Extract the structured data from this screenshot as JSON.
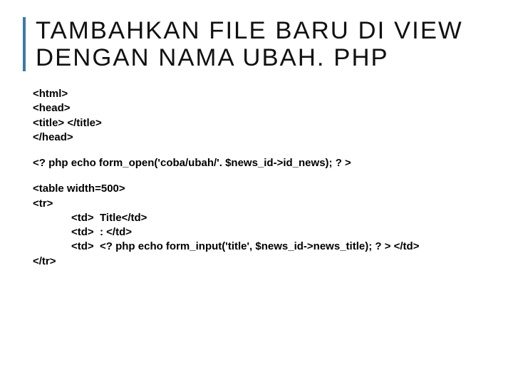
{
  "title": "TAMBAHKAN FILE BARU DI VIEW DENGAN NAMA UBAH. PHP",
  "block1": {
    "l1": "<html>",
    "l2": "<head>",
    "l3": "<title> </title>",
    "l4": "</head>"
  },
  "block2": {
    "l1": "<? php echo form_open('coba/ubah/'. $news_id->id_news); ? >"
  },
  "block3": {
    "l1": "<table width=500>",
    "l2": "<tr>",
    "l3": "<td>  Title</td>",
    "l4": "<td>  : </td>",
    "l5": "<td>  <? php echo form_input('title', $news_id->news_title); ? > </td>",
    "l6": "</tr>"
  }
}
